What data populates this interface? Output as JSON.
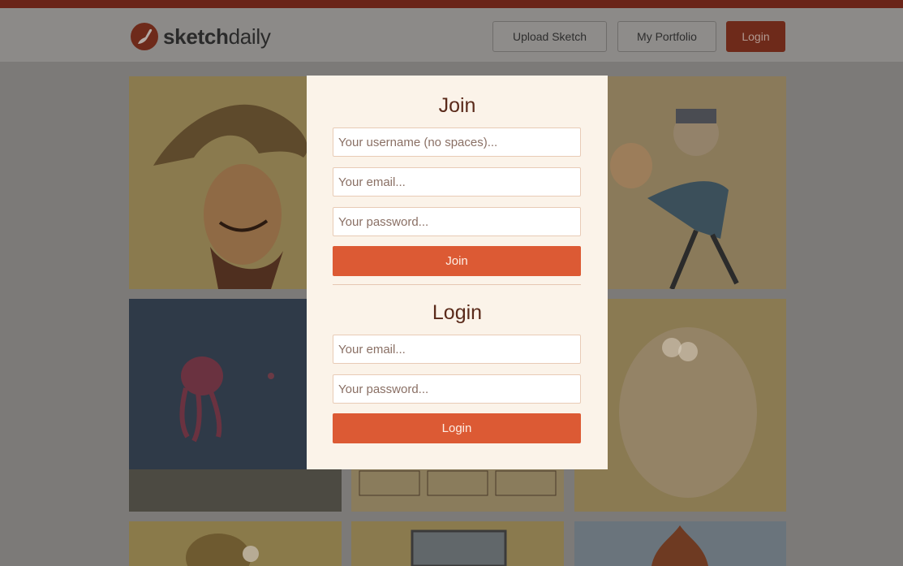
{
  "header": {
    "logo_bold": "sketch",
    "logo_light": "daily",
    "nav": {
      "upload_label": "Upload Sketch",
      "portfolio_label": "My Portfolio",
      "login_label": "Login"
    }
  },
  "join_form": {
    "title": "Join",
    "username_placeholder": "Your username (no spaces)...",
    "email_placeholder": "Your email...",
    "password_placeholder": "Your password...",
    "button_label": "Join"
  },
  "login_form": {
    "title": "Login",
    "email_placeholder": "Your email...",
    "password_placeholder": "Your password...",
    "button_label": "Login"
  },
  "gallery": {
    "tiles": [
      {
        "subject": "cowboy caricature sketch"
      },
      {
        "subject": "dancing cartoon couple sketch"
      },
      {
        "subject": "underwater octopus scene"
      },
      {
        "subject": "character expression sheet"
      },
      {
        "subject": "bald man with glasses sketch"
      },
      {
        "subject": "toucan cartoon sketch"
      },
      {
        "subject": "framed portrait sketch"
      },
      {
        "subject": "onion character sketch"
      }
    ]
  },
  "colors": {
    "brand_accent": "#dc5a34",
    "modal_background": "#fbf3e9",
    "heading_text": "#5a2a1a",
    "dimmed_overlay": "#7c7a78"
  }
}
